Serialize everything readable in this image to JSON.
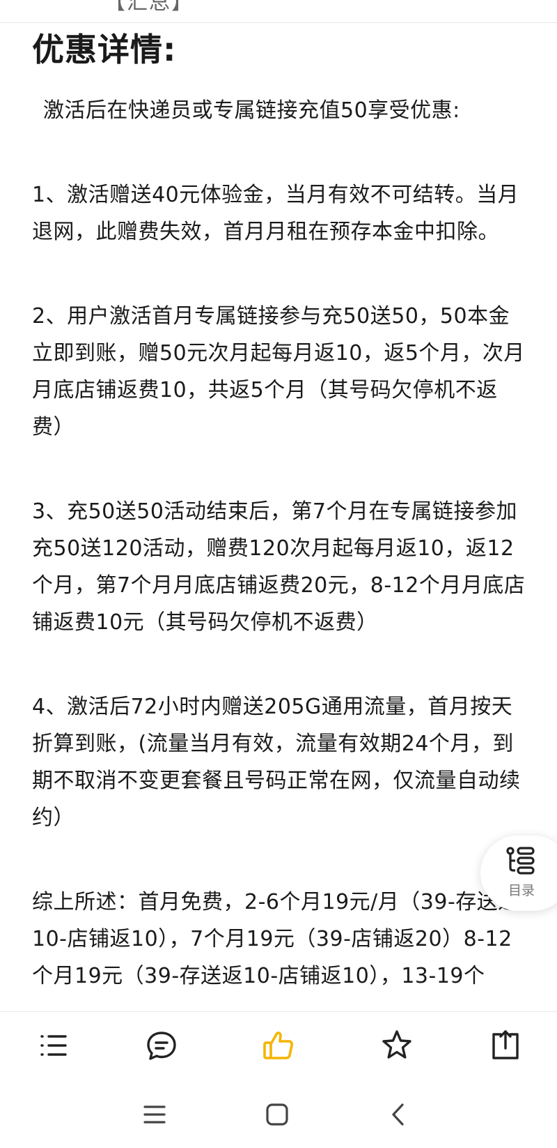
{
  "top_strip": {
    "partial_text": "【汇总】"
  },
  "article": {
    "title": "优惠详情:",
    "intro": "激活后在快递员或专属链接充值50享受优惠:",
    "paragraphs": [
      "1、激活赠送40元体验金，当月有效不可结转。当月退网，此赠费失效，首月月租在预存本金中扣除。",
      "2、用户激活首月专属链接参与充50送50，50本金立即到账，赠50元次月起每月返10，返5个月，次月月底店铺返费10，共返5个月（其号码欠停机不返费）",
      "3、充50送50活动结束后，第7个月在专属链接参加充50送120活动，赠费120次月起每月返10，返12个月，第7个月月底店铺返费20元，8-12个月月底店铺返费10元（其号码欠停机不返费）",
      "4、激活后72小时内赠送205G通用流量，首月按天折算到账，(流量当月有效，流量有效期24个月，到期不取消不变更套餐且号码正常在网，仅流量自动续约）",
      "综上所述：首月免费，2-6个月19元/月（39-存送返10-店铺返10），7个月19元（39-店铺返20）8-12个月19元（39-存送返10-店铺返10），13-19个"
    ]
  },
  "toc_button": {
    "label": "目录",
    "icon": "toc-icon"
  },
  "bottom_bar": {
    "icons": [
      "menu-list-icon",
      "comment-icon",
      "like-thumb-icon",
      "star-icon",
      "share-icon"
    ],
    "accent_color": "#f5b400"
  },
  "system_nav": {
    "icons": [
      "recent-apps-icon",
      "home-icon",
      "back-icon"
    ]
  }
}
